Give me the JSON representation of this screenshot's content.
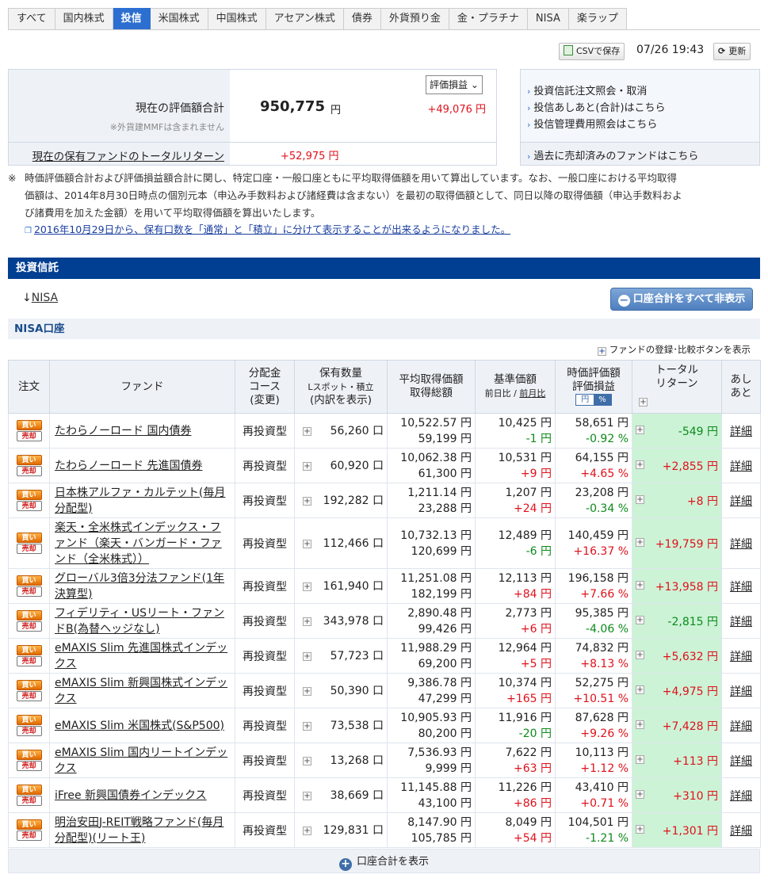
{
  "tabs": [
    "すべて",
    "国内株式",
    "投信",
    "米国株式",
    "中国株式",
    "アセアン株式",
    "債券",
    "外貨預り金",
    "金・プラチナ",
    "NISA",
    "楽ラップ"
  ],
  "active_tab": 2,
  "toolbar": {
    "csv": "CSVで保存",
    "timestamp": "07/26 19:43",
    "refresh": "更新"
  },
  "summary": {
    "total_label": "現在の評価額合計",
    "total_note": "※外貨建MMFは含まれません",
    "total_value": "950,775",
    "total_unit": "円",
    "select_value": "評価損益",
    "gain": "+49,076 円",
    "return_label": "現在の保有ファンドのトータルリターン",
    "return_value": "+52,975 円"
  },
  "links": [
    "投資信託注文照会・取消",
    "投信あしあと(合計)はこちら",
    "投信管理費用照会はこちら",
    "過去に売却済みのファンドはこちら"
  ],
  "notes": {
    "mark": "※",
    "line1": "時価評価額合計および評価損益額合計に関し、特定口座・一般口座ともに平均取得価額を用いて算出しています。なお、一般口座における平均取得",
    "line2": "価額は、2014年8月30日時点の個別元本（申込み手数料および諸経費は含まない）を最初の取得価額として、同日以降の取得価額（申込手数料およ",
    "line3": "び諸費用を加えた金額）を用いて平均取得価額を算出いたします。",
    "link": "2016年10月29日から、保有口数を「通常」と「積立」に分けて表示することが出来るようになりました。"
  },
  "section_title": "投資信託",
  "nisa_anchor": "↓",
  "nisa_anchor_label": "NISA",
  "hide_all": "口座合計をすべて非表示",
  "nisa_account": "NISA口座",
  "compare_label": "ファンドの登録･比較ボタンを表示",
  "headers": {
    "order": "注文",
    "fund": "ファンド",
    "course1": "分配金",
    "course2": "コース",
    "course3": "(変更)",
    "qty1": "保有数量",
    "qty2": "Lスポット・積立",
    "qty3": "(内訳を表示)",
    "avg1": "平均取得価額",
    "avg2": "取得総額",
    "base1": "基準価額",
    "base2": "前日比",
    "base_sep": "/",
    "base3": "前月比",
    "val1": "時価評価額",
    "val2": "評価損益",
    "toggle_yen": "円",
    "toggle_pct": "%",
    "tr1": "トータル",
    "tr2": "リターン",
    "ashi1": "あし",
    "ashi2": "あと"
  },
  "buy_label": "買い",
  "sell_label": "売却",
  "detail_label": "詳細",
  "rows": [
    {
      "fund": "たわらノーロード 国内債券",
      "course": "再投資型",
      "qty": "56,260 口",
      "avg": "10,522.57 円",
      "cost": "59,199 円",
      "nav": "10,425 円",
      "diff": "-1 円",
      "diff_sign": "neg",
      "value": "58,651 円",
      "pl": "-0.92 %",
      "pl_sign": "neg",
      "total": "-549 円",
      "total_sign": "neg"
    },
    {
      "fund": "たわらノーロード 先進国債券",
      "course": "再投資型",
      "qty": "60,920 口",
      "avg": "10,062.38 円",
      "cost": "61,300 円",
      "nav": "10,531 円",
      "diff": "+9 円",
      "diff_sign": "pos",
      "value": "64,155 円",
      "pl": "+4.65 %",
      "pl_sign": "pos",
      "total": "+2,855 円",
      "total_sign": "pos"
    },
    {
      "fund": "日本株アルファ・カルテット(毎月分配型)",
      "course": "再投資型",
      "qty": "192,282 口",
      "avg": "1,211.14 円",
      "cost": "23,288 円",
      "nav": "1,207 円",
      "diff": "+24 円",
      "diff_sign": "pos",
      "value": "23,208 円",
      "pl": "-0.34 %",
      "pl_sign": "neg",
      "total": "+8 円",
      "total_sign": "pos"
    },
    {
      "fund": "楽天・全米株式インデックス・ファンド（楽天・バンガード・ファンド（全米株式））",
      "course": "再投資型",
      "qty": "112,466 口",
      "avg": "10,732.13 円",
      "cost": "120,699 円",
      "nav": "12,489 円",
      "diff": "-6 円",
      "diff_sign": "neg",
      "value": "140,459 円",
      "pl": "+16.37 %",
      "pl_sign": "pos",
      "total": "+19,759 円",
      "total_sign": "pos"
    },
    {
      "fund": "グローバル3倍3分法ファンド(1年決算型)",
      "course": "再投資型",
      "qty": "161,940 口",
      "avg": "11,251.08 円",
      "cost": "182,199 円",
      "nav": "12,113 円",
      "diff": "+84 円",
      "diff_sign": "pos",
      "value": "196,158 円",
      "pl": "+7.66 %",
      "pl_sign": "pos",
      "total": "+13,958 円",
      "total_sign": "pos"
    },
    {
      "fund": "フィデリティ・USリート・ファンドB(為替ヘッジなし)",
      "course": "再投資型",
      "qty": "343,978 口",
      "avg": "2,890.48 円",
      "cost": "99,426 円",
      "nav": "2,773 円",
      "diff": "+6 円",
      "diff_sign": "pos",
      "value": "95,385 円",
      "pl": "-4.06 %",
      "pl_sign": "neg",
      "total": "-2,815 円",
      "total_sign": "neg"
    },
    {
      "fund": "eMAXIS Slim 先進国株式インデックス",
      "course": "再投資型",
      "qty": "57,723 口",
      "avg": "11,988.29 円",
      "cost": "69,200 円",
      "nav": "12,964 円",
      "diff": "+5 円",
      "diff_sign": "pos",
      "value": "74,832 円",
      "pl": "+8.13 %",
      "pl_sign": "pos",
      "total": "+5,632 円",
      "total_sign": "pos"
    },
    {
      "fund": "eMAXIS Slim 新興国株式インデックス",
      "course": "再投資型",
      "qty": "50,390 口",
      "avg": "9,386.78 円",
      "cost": "47,299 円",
      "nav": "10,374 円",
      "diff": "+165 円",
      "diff_sign": "pos",
      "value": "52,275 円",
      "pl": "+10.51 %",
      "pl_sign": "pos",
      "total": "+4,975 円",
      "total_sign": "pos"
    },
    {
      "fund": "eMAXIS Slim 米国株式(S&P500)",
      "course": "再投資型",
      "qty": "73,538 口",
      "avg": "10,905.93 円",
      "cost": "80,200 円",
      "nav": "11,916 円",
      "diff": "-20 円",
      "diff_sign": "neg",
      "value": "87,628 円",
      "pl": "+9.26 %",
      "pl_sign": "pos",
      "total": "+7,428 円",
      "total_sign": "pos"
    },
    {
      "fund": "eMAXIS Slim 国内リートインデックス",
      "course": "再投資型",
      "qty": "13,268 口",
      "avg": "7,536.93 円",
      "cost": "9,999 円",
      "nav": "7,622 円",
      "diff": "+63 円",
      "diff_sign": "pos",
      "value": "10,113 円",
      "pl": "+1.12 %",
      "pl_sign": "pos",
      "total": "+113 円",
      "total_sign": "pos"
    },
    {
      "fund": "iFree 新興国債券インデックス",
      "course": "再投資型",
      "qty": "38,669 口",
      "avg": "11,145.88 円",
      "cost": "43,100 円",
      "nav": "11,226 円",
      "diff": "+86 円",
      "diff_sign": "pos",
      "value": "43,410 円",
      "pl": "+0.71 %",
      "pl_sign": "pos",
      "total": "+310 円",
      "total_sign": "pos"
    },
    {
      "fund": "明治安田J-REIT戦略ファンド(毎月分配型)(リート王)",
      "course": "再投資型",
      "qty": "129,831 口",
      "avg": "8,147.90 円",
      "cost": "105,785 円",
      "nav": "8,049 円",
      "diff": "+54 円",
      "diff_sign": "pos",
      "value": "104,501 円",
      "pl": "-1.21 %",
      "pl_sign": "neg",
      "total": "+1,301 円",
      "total_sign": "pos"
    }
  ],
  "show_total": "口座合計を表示",
  "colors": {
    "accent": "#2d6fd1",
    "section": "#003f91",
    "positive": "#e0111b",
    "negative": "#0d8a1b",
    "total_bg": "#ccf3d6"
  }
}
